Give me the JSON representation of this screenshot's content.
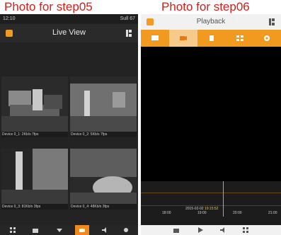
{
  "captions": {
    "left": "Photo for step05",
    "right": "Photo for step06"
  },
  "live_view": {
    "status_bar": {
      "time": "12:10",
      "right": "Sull 67"
    },
    "title": "Live View",
    "cameras": [
      {
        "label": "Device 0_1: 2Kb/s 7fps"
      },
      {
        "label": "Device 0_2: 5Kb/s 7fps"
      },
      {
        "label": "Device 0_3: 81Kb/s 3fps"
      },
      {
        "label": "Device 0_4: 48Kb/s 3fps"
      }
    ]
  },
  "playback": {
    "title": "Playback",
    "timestamp_date": "2015-02-02",
    "timestamp_time": "19:15:52",
    "ticks": [
      "18:00",
      "19:00",
      "20:00",
      "21:00"
    ]
  },
  "colors": {
    "accent": "#f29a20",
    "caption_red": "#d0211c"
  }
}
